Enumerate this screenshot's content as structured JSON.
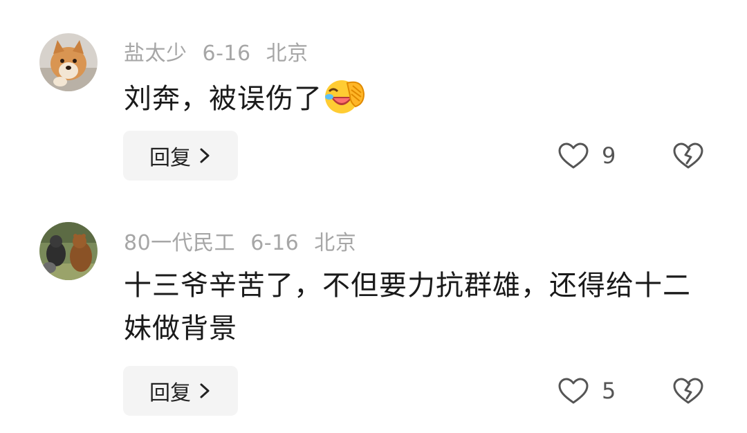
{
  "comments": [
    {
      "username": "盐太少",
      "date": "6-16",
      "location": "北京",
      "text": "刘奔，被误伤了",
      "emoji": "laughing-face-with-hand-emoji",
      "reply_label": "回复",
      "likes": "9",
      "avatar": "shiba-dog-avatar"
    },
    {
      "username": "80一代民工",
      "date": "6-16",
      "location": "北京",
      "text": "十三爷辛苦了，不但要力抗群雄，还得给十二妹做背景",
      "reply_label": "回复",
      "likes": "5",
      "avatar": "animals-avatar"
    }
  ],
  "icons": {
    "like": "heart-outline-icon",
    "dislike": "broken-heart-icon",
    "reply_chevron": "chevron-right-icon"
  },
  "colors": {
    "meta_text": "#a6a6a6",
    "body_text": "#1a1a1a",
    "button_bg": "#f4f4f4",
    "icon_stroke": "#555555"
  }
}
